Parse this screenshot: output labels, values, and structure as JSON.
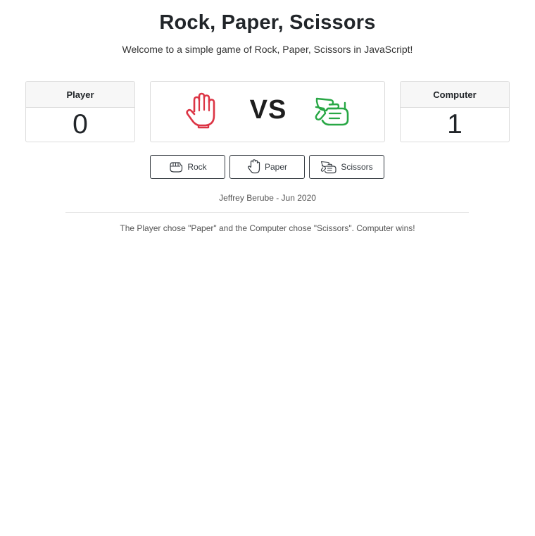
{
  "header": {
    "title": "Rock, Paper, Scissors",
    "subtitle": "Welcome to a simple game of Rock, Paper, Scissors in JavaScript!"
  },
  "scoreboard": {
    "player": {
      "label": "Player",
      "score": "0"
    },
    "computer": {
      "label": "Computer",
      "score": "1"
    }
  },
  "versus": {
    "text": "VS",
    "player_hand_icon": "paper-hand-icon",
    "computer_hand_icon": "scissors-hand-icon",
    "player_color": "#dc3545",
    "computer_color": "#28a745"
  },
  "buttons": {
    "rock": {
      "label": "Rock",
      "icon": "rock-hand-icon"
    },
    "paper": {
      "label": "Paper",
      "icon": "paper-hand-icon"
    },
    "scissors": {
      "label": "Scissors",
      "icon": "scissors-hand-icon"
    }
  },
  "footer": {
    "credit": "Jeffrey Berube - Jun 2020",
    "result": "The Player chose \"Paper\" and the Computer chose \"Scissors\". Computer wins!"
  }
}
